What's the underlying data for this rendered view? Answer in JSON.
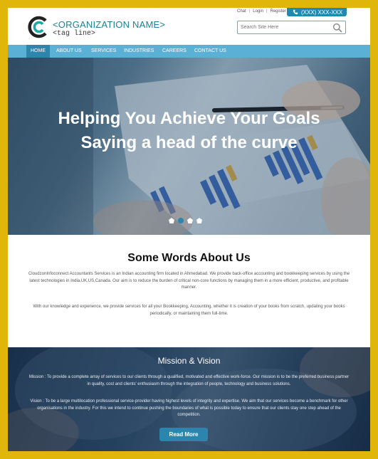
{
  "header": {
    "org_name": "<ORGANIZATION NAME>",
    "tagline": "<tag line>",
    "top_links": [
      "Chat",
      "Login",
      "Register"
    ],
    "phone": "(XXX) XXX-XXX",
    "search_placeholder": "Search Site Here"
  },
  "nav": {
    "items": [
      "HOME",
      "ABOUT US",
      "SERVICES",
      "INDUSTRIES",
      "CAREERS",
      "CONTACT US"
    ],
    "active": "HOME"
  },
  "hero": {
    "line1": "Helping You Achieve Your Goals",
    "line2": "Saying a head of the curve",
    "slide_count": 4,
    "active_slide": 2
  },
  "about": {
    "title": "Some Words About Us",
    "p1": "CloudzonInfoconnect Accountants Services is an Indian accounting firm located in Ahmedabad. We provide back-office accounting and bookkeeping services by using the latest technologies in India,UK,US,Canada. Our aim is to reduce the burden of critical non-core functions by managing them in a more efficient, productive, and profitable manner.",
    "p2": "With our knowledge and experience, we provide services for all your Bookkeeping, Accounting, whether it is creation of your books from scratch, updating your books periodically, or maintaining them full-time."
  },
  "mission": {
    "title": "Mission & Vision",
    "p1": "Mission : To provide a complete array of services to our clients through a qualified, motivated and effective work-force. Our mission is to be the preferred business partner in quality, cost and clients' enthusiasm through the integration of people, technology and business solutions.",
    "p2": "Vision : To be a large multilocation professional service-provider having highest levels of integrity and expertise. We aim that our services become a benchmark for other organisations in the industry. For this we intend to continue pushing the boundaries of what is possible today to ensure that our clients stay one step ahead of the competition.",
    "button": "Read More"
  },
  "colors": {
    "frame": "#e0b60a",
    "nav": "#5bb0d6",
    "accent": "#2b85ad",
    "brand_text": "#1d7f96"
  },
  "icons": [
    "logo-c-icon",
    "phone-icon",
    "search-icon"
  ]
}
